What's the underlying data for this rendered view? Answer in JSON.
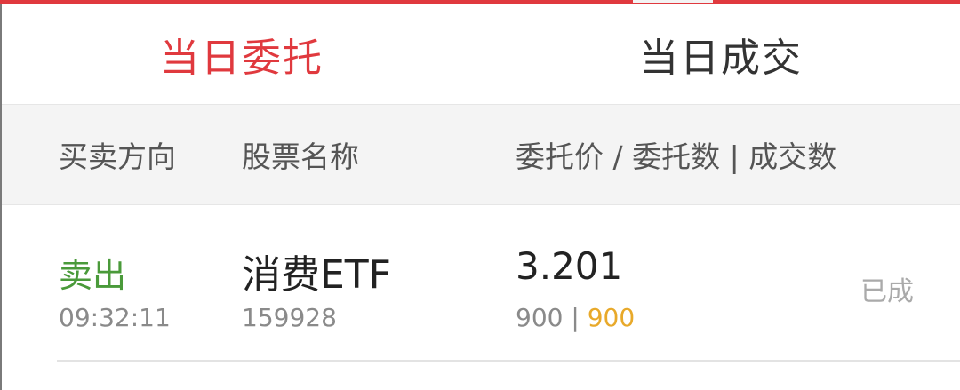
{
  "colors": {
    "accent": "#e0393e",
    "sell": "#4a9a3a",
    "filled_qty": "#e8a92a",
    "muted": "#8a8a8a",
    "header_bg": "#f4f4f4"
  },
  "tabs": [
    {
      "label": "当日委托",
      "active": true
    },
    {
      "label": "当日成交",
      "active": false
    }
  ],
  "table_header": {
    "direction": "买卖方向",
    "stock_name": "股票名称",
    "price_qty": "委托价 / 委托数 | 成交数"
  },
  "orders": [
    {
      "direction": "卖出",
      "time": "09:32:11",
      "stock_name": "消费ETF",
      "stock_code": "159928",
      "price": "3.201",
      "order_qty": "900",
      "separator": "|",
      "filled_qty": "900",
      "status": "已成"
    }
  ]
}
